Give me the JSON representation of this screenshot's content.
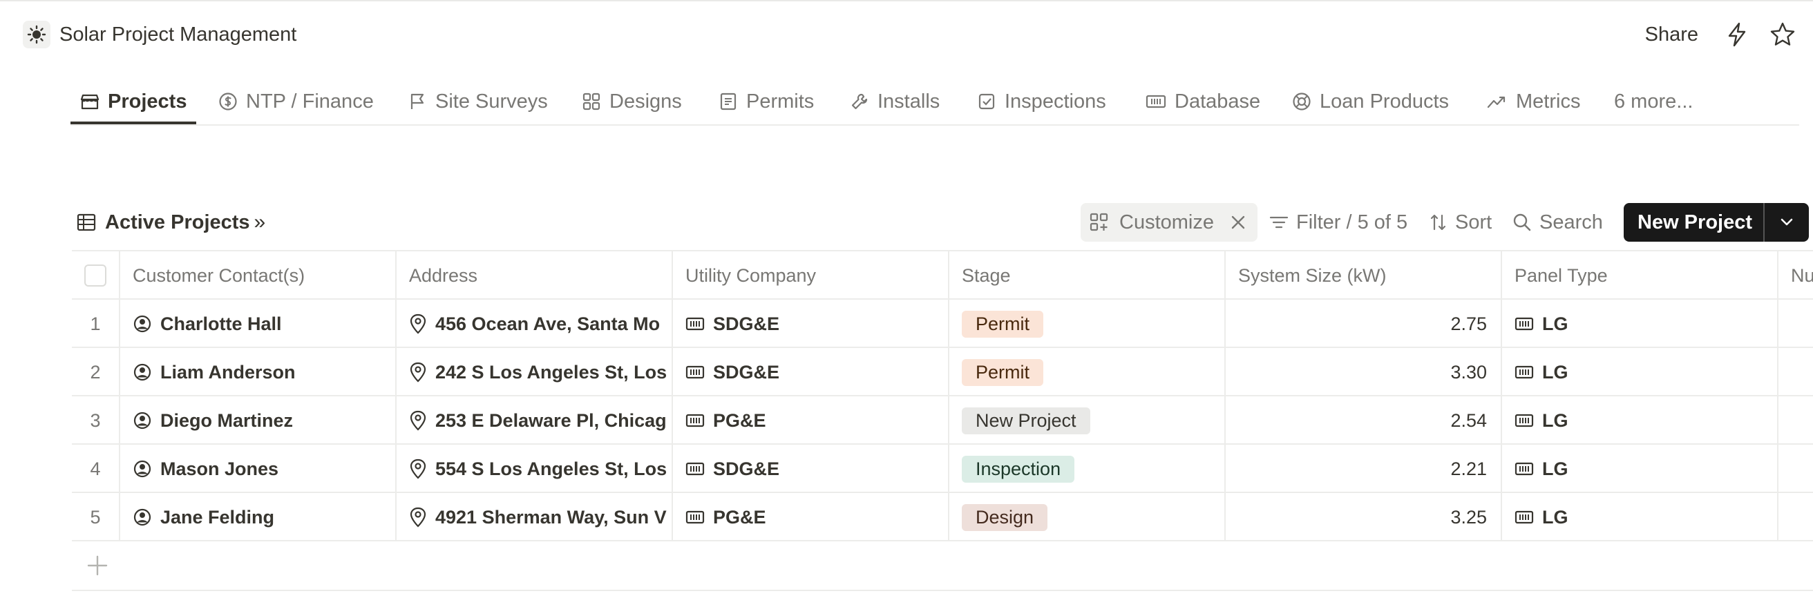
{
  "app": {
    "title": "Solar Project Management",
    "share_label": "Share"
  },
  "tabs": [
    {
      "label": "Projects",
      "icon": "store-icon"
    },
    {
      "label": "NTP / Finance",
      "icon": "dollar-circle-icon"
    },
    {
      "label": "Site Surveys",
      "icon": "flag-icon"
    },
    {
      "label": "Designs",
      "icon": "grid-icon"
    },
    {
      "label": "Permits",
      "icon": "document-icon"
    },
    {
      "label": "Installs",
      "icon": "wrench-icon"
    },
    {
      "label": "Inspections",
      "icon": "checkbox-icon"
    },
    {
      "label": "Database",
      "icon": "panel-icon"
    },
    {
      "label": "Loan Products",
      "icon": "lifebuoy-icon"
    },
    {
      "label": "Metrics",
      "icon": "trend-icon"
    }
  ],
  "more_tabs_label": "6 more...",
  "view": {
    "title": "Active Projects",
    "customize_label": "Customize",
    "filter_label": "Filter / 5 of 5",
    "sort_label": "Sort",
    "search_label": "Search",
    "new_button_label": "New Project"
  },
  "columns": [
    "Customer Contact(s)",
    "Address",
    "Utility Company",
    "Stage",
    "System Size (kW)",
    "Panel Type",
    "Nu"
  ],
  "rows": [
    {
      "num": "1",
      "contact": "Charlotte Hall",
      "address": "456 Ocean Ave, Santa Mo",
      "utility": "SDG&E",
      "stage": "Permit",
      "size": "2.75",
      "panel": "LG"
    },
    {
      "num": "2",
      "contact": "Liam Anderson",
      "address": "242 S Los Angeles St, Los",
      "utility": "SDG&E",
      "stage": "Permit",
      "size": "3.30",
      "panel": "LG"
    },
    {
      "num": "3",
      "contact": "Diego Martinez",
      "address": "253 E Delaware Pl, Chicag",
      "utility": "PG&E",
      "stage": "New Project",
      "size": "2.54",
      "panel": "LG"
    },
    {
      "num": "4",
      "contact": "Mason Jones",
      "address": "554 S Los Angeles St, Los",
      "utility": "SDG&E",
      "stage": "Inspection",
      "size": "2.21",
      "panel": "LG"
    },
    {
      "num": "5",
      "contact": "Jane Felding",
      "address": "4921 Sherman Way, Sun V",
      "utility": "PG&E",
      "stage": "Design",
      "size": "3.25",
      "panel": "LG"
    }
  ],
  "stage_colors": {
    "Permit": {
      "bg": "#fbe4d7",
      "fg": "#49290e"
    },
    "New Project": {
      "bg": "#e9e9e7",
      "fg": "#37352f"
    },
    "Inspection": {
      "bg": "#dbede6",
      "fg": "#1c3829"
    },
    "Design": {
      "bg": "#eedfda",
      "fg": "#442a1e"
    }
  }
}
